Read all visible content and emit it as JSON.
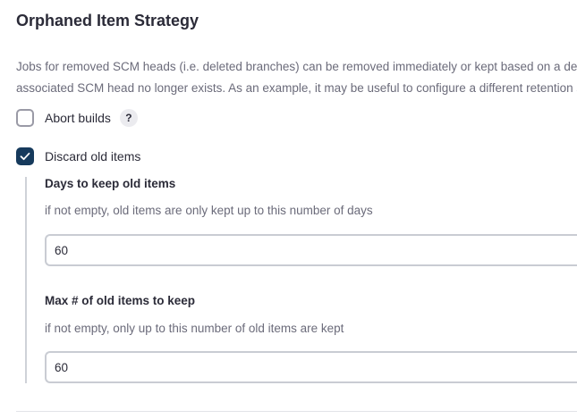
{
  "section": {
    "title": "Orphaned Item Strategy",
    "description_line1": "Jobs for removed SCM heads (i.e. deleted branches) can be removed immediately or kept based on a des",
    "description_line2": "associated SCM head no longer exists. As an example, it may be useful to configure a different retention s"
  },
  "abort_builds": {
    "label": "Abort builds",
    "checked": false,
    "help_label": "?"
  },
  "discard_old_items": {
    "label": "Discard old items",
    "checked": true
  },
  "days_to_keep": {
    "label": "Days to keep old items",
    "help": "if not empty, old items are only kept up to this number of days",
    "value": "60"
  },
  "max_items": {
    "label": "Max # of old items to keep",
    "help": "if not empty, only up to this number of old items are kept",
    "value": "60"
  },
  "colors": {
    "checkbox_checked": "#163a5c",
    "text_primary": "#2b2b38",
    "text_secondary": "#6b6b7a"
  }
}
